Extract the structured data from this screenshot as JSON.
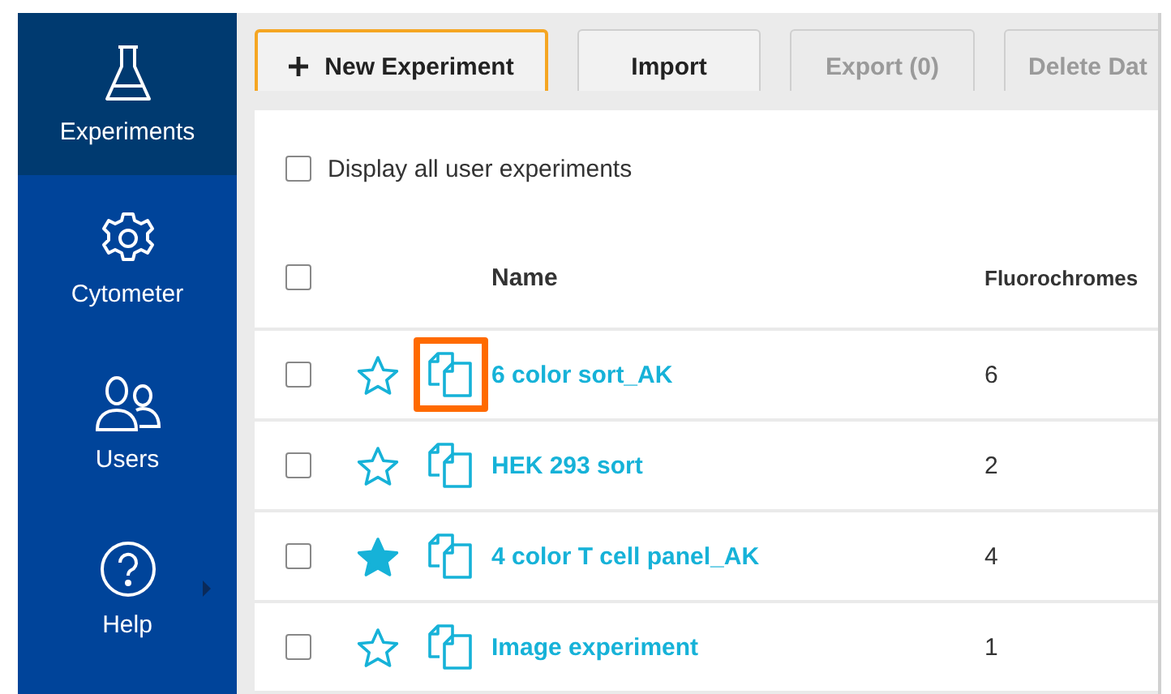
{
  "sidebar": {
    "items": [
      {
        "label": "Experiments",
        "selected": true,
        "submenu": false
      },
      {
        "label": "Cytometer",
        "selected": false,
        "submenu": false
      },
      {
        "label": "Users",
        "selected": false,
        "submenu": false
      },
      {
        "label": "Help",
        "selected": false,
        "submenu": true
      }
    ]
  },
  "toolbar": {
    "buttons": [
      {
        "label": "New Experiment",
        "kind": "add",
        "disabled": false,
        "focused": true
      },
      {
        "label": "Import",
        "kind": "plain",
        "disabled": false,
        "focused": false
      },
      {
        "label": "Export (0)",
        "kind": "plain",
        "disabled": true,
        "focused": false
      },
      {
        "label": "Delete Dat",
        "kind": "plain",
        "disabled": true,
        "focused": false
      }
    ]
  },
  "display_all": {
    "label": "Display all user experiments",
    "checked": false
  },
  "table": {
    "select_all": {
      "checked": false
    },
    "columns": [
      "Name",
      "Fluorochromes"
    ],
    "rows": [
      {
        "checked": false,
        "favorite": false,
        "highlighted": true,
        "name": "6 color sort_AK",
        "fluorochromes": "6"
      },
      {
        "checked": false,
        "favorite": false,
        "highlighted": false,
        "name": "HEK 293 sort",
        "fluorochromes": "2"
      },
      {
        "checked": false,
        "favorite": true,
        "highlighted": false,
        "name": "4 color T cell panel_AK",
        "fluorochromes": "4"
      },
      {
        "checked": false,
        "favorite": false,
        "highlighted": false,
        "name": "Image experiment",
        "fluorochromes": "1"
      }
    ]
  }
}
